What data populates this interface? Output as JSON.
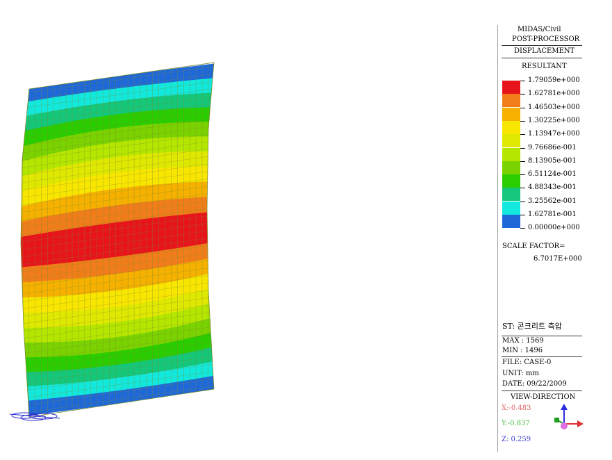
{
  "header": {
    "line1": "MIDAS/Civil",
    "line2": "POST-PROCESSOR"
  },
  "result": {
    "type": "DISPLACEMENT",
    "component": "RESULTANT"
  },
  "legend": {
    "values": [
      "1.79059e+000",
      "1.62781e+000",
      "1.46503e+000",
      "1.30225e+000",
      "1.13947e+000",
      "9.76686e-001",
      "8.13905e-001",
      "6.51124e-001",
      "4.88343e-001",
      "3.25562e-001",
      "1.62781e-001",
      "0.00000e+000"
    ],
    "colors": [
      "#e8141b",
      "#f07d1a",
      "#f5b000",
      "#f8e600",
      "#dfe800",
      "#b4e600",
      "#7ad200",
      "#2acd00",
      "#14c77a",
      "#12e8dc",
      "#1f68d8"
    ]
  },
  "scale": {
    "label": "SCALE FACTOR=",
    "value": "6.7017E+000"
  },
  "stage": "ST: 콘크리트 측압",
  "extremes": {
    "max": "MAX : 1569",
    "min": "MIN : 1496"
  },
  "info": {
    "file": "FILE: CASE-0",
    "unit": "UNIT: mm",
    "date": "DATE: 09/22/2009"
  },
  "view": {
    "title": "VIEW-DIRECTION",
    "x": "X:-0.483",
    "y": "Y:-0.837",
    "z": "Z: 0.259",
    "x_color": "#e06060",
    "y_color": "#3fbf3f",
    "z_color": "#3b3bd6"
  },
  "contour_bands": [
    "#1f68d8",
    "#12e8dc",
    "#14c77a",
    "#2acd00",
    "#7ad200",
    "#b4e600",
    "#dfe800",
    "#f8e600",
    "#f5b000",
    "#f07d1a",
    "#e8141b",
    "#e8141b",
    "#f07d1a",
    "#f5b000",
    "#f8e600",
    "#dfe800",
    "#b4e600",
    "#7ad200",
    "#2acd00",
    "#14c77a",
    "#12e8dc",
    "#1f68d8"
  ]
}
